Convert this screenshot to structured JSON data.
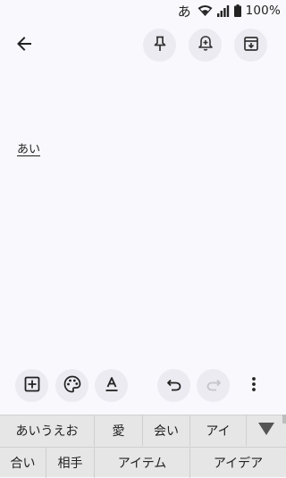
{
  "status_bar": {
    "ime_indicator": "あ",
    "wifi_icon": "wifi-icon",
    "signal_icon": "signal-icon",
    "battery_icon": "battery-icon",
    "battery_level": "100%"
  },
  "top_bar": {
    "back_icon": "arrow-back-icon",
    "actions": [
      {
        "name": "pin",
        "icon": "pin-icon"
      },
      {
        "name": "reminder",
        "icon": "bell-plus-icon"
      },
      {
        "name": "archive",
        "icon": "archive-icon"
      }
    ]
  },
  "note": {
    "body": "あい"
  },
  "bottom_toolbar": {
    "icons": [
      "add-box-icon",
      "palette-icon",
      "text-format-icon",
      "undo-icon",
      "redo-icon",
      "more-vert-icon"
    ]
  },
  "ime_candidates": {
    "row1": [
      "あいうえお",
      "愛",
      "会い",
      "アイ"
    ],
    "row2": [
      "合い",
      "相手",
      "アイテム",
      "アイデア"
    ],
    "expand_icon": "triangle-down-icon"
  },
  "colors": {
    "background": "#f9f8fd",
    "button_bg": "#ecebf1",
    "candidate_bg": "#e6e6e6"
  }
}
